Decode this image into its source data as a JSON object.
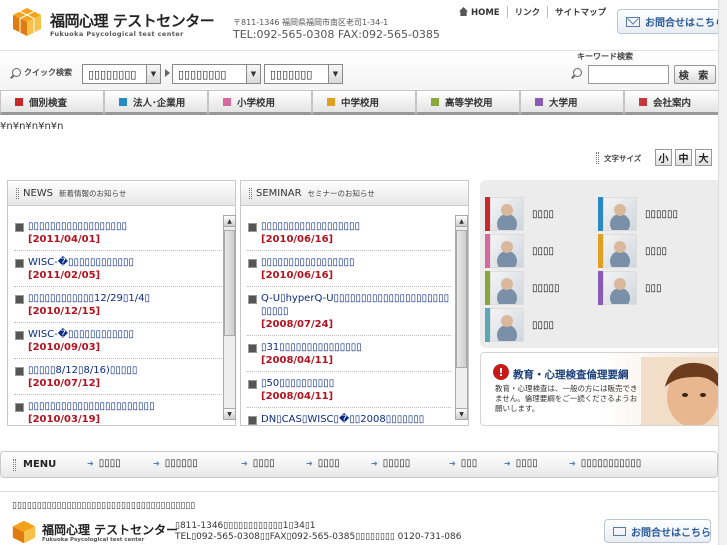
{
  "header": {
    "logo_jp": "福岡心理 テストセンター",
    "logo_en": "Fukuoka Psycological test center",
    "address": "〒811-1346 福岡県福岡市南区老司1-34-1",
    "tel_fax": "TEL:092-565-0308 FAX:092-565-0385",
    "links": [
      "HOME",
      "リンク",
      "サイトマップ"
    ],
    "contact_label": "お問合せはこちら"
  },
  "search": {
    "quick_label": "クイック検索",
    "selects": [
      "▯▯▯▯▯▯▯▯",
      "▯▯▯▯▯▯▯▯",
      "▯▯▯▯▯▯▯"
    ],
    "keyword_label": "キーワード検索",
    "keyword_value": "",
    "button_label": "検 索"
  },
  "nav": {
    "tabs": [
      {
        "label": "個別検査",
        "color": "#c42a2a"
      },
      {
        "label": "法人･企業用",
        "color": "#2a8ac4"
      },
      {
        "label": "小学校用",
        "color": "#d66aa0"
      },
      {
        "label": "中学校用",
        "color": "#e0a020"
      },
      {
        "label": "高等学校用",
        "color": "#8aa83a"
      },
      {
        "label": "大学用",
        "color": "#8a5ab8"
      },
      {
        "label": "会社案内",
        "color": "#c43a3a"
      }
    ]
  },
  "artifact_text": "¥n¥n¥n¥n¥n",
  "fontsize": {
    "label": "文字サイズ",
    "small": "小",
    "medium": "中",
    "large": "大"
  },
  "news": {
    "title": "NEWS",
    "subtitle": "新着情報のお知らせ",
    "items": [
      {
        "title": "▯▯▯▯▯▯▯▯▯▯▯▯▯▯▯▯▯▯",
        "date": "[2011/04/01]"
      },
      {
        "title": "WISC-�▯▯▯▯▯▯▯▯▯▯▯▯",
        "date": "[2011/02/05]"
      },
      {
        "title": "▯▯▯▯▯▯▯▯▯▯▯▯12/29▯1/4▯",
        "date": "[2010/12/15]"
      },
      {
        "title": "WISC-�▯▯▯▯▯▯▯▯▯▯▯▯",
        "date": "[2010/09/03]"
      },
      {
        "title": "▯▯▯▯▯8/12▯8/16)▯▯▯▯▯",
        "date": "[2010/07/12]"
      },
      {
        "title": "▯▯▯▯▯▯▯▯▯▯▯▯▯▯▯▯▯▯▯▯▯▯▯",
        "date": "[2010/03/19]"
      }
    ]
  },
  "seminar": {
    "title": "SEMINAR",
    "subtitle": "セミナーのお知らせ",
    "items": [
      {
        "title": "▯▯▯▯▯▯▯▯▯▯▯▯▯▯▯▯▯▯",
        "date": "[2010/06/16]"
      },
      {
        "title": "▯▯▯▯▯▯▯▯▯▯▯▯▯▯▯▯▯",
        "date": "[2010/06/16]"
      },
      {
        "title": "Q-U▯hyperQ-U▯▯▯▯▯▯▯▯▯▯▯▯▯▯▯▯▯▯▯▯▯▯▯▯▯▯",
        "date": "[2008/07/24]"
      },
      {
        "title": "▯31▯▯▯▯▯▯▯▯▯▯▯▯▯▯▯",
        "date": "[2008/04/11]"
      },
      {
        "title": "▯50▯▯▯▯▯▯▯▯▯▯",
        "date": "[2008/04/11]"
      },
      {
        "title": "DN▯CAS▯WISC▯�▯▯2008▯▯▯▯▯▯▯",
        "date": ""
      }
    ]
  },
  "side_menu": {
    "items": [
      {
        "label": "▯▯▯▯",
        "color": "#c42a2a"
      },
      {
        "label": "▯▯▯▯▯▯",
        "color": "#2a8ac4"
      },
      {
        "label": "▯▯▯▯",
        "color": "#d66aa0"
      },
      {
        "label": "▯▯▯▯",
        "color": "#e0a020"
      },
      {
        "label": "▯▯▯▯▯",
        "color": "#8aa83a"
      },
      {
        "label": "▯▯▯",
        "color": "#8a5ab8"
      },
      {
        "label": "▯▯▯▯",
        "color": "#5aa8b8"
      }
    ]
  },
  "ethics": {
    "title": "教育・心理検査倫理要綱",
    "body": "教育・心理検査は、一般の方には販売できません。倫理要綱をご一読くださるようお願いします。"
  },
  "bottom_menu": {
    "label": "MENU",
    "links": [
      "▯▯▯▯",
      "▯▯▯▯▯▯",
      "▯▯▯▯",
      "▯▯▯▯",
      "▯▯▯▯▯",
      "▯▯▯",
      "▯▯▯▯",
      "▯▯▯▯▯▯▯▯▯▯▯"
    ]
  },
  "footer": {
    "copyright": "▯▯▯▯▯▯▯▯▯▯▯▯▯▯▯▯▯▯▯▯▯▯▯▯▯▯▯▯▯▯▯▯▯▯▯▯▯",
    "logo_jp": "福岡心理 テストセンター",
    "logo_en": "Fukuoka Psycological test center",
    "address": "▯811-1346▯▯▯▯▯▯▯▯▯▯▯▯1▯34▯1",
    "tel": "TEL▯092-565-0308▯▯FAX▯092-565-0385▯▯▯▯▯▯▯▯ 0120-731-086",
    "contact_label": "お問合せはこちら"
  }
}
